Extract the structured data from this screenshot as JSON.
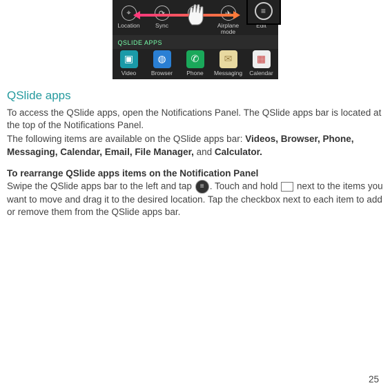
{
  "screenshot": {
    "toggles": [
      {
        "name": "location",
        "label": "Location",
        "glyph": "⌖"
      },
      {
        "name": "sync",
        "label": "Sync",
        "glyph": "⟳"
      },
      {
        "name": "blank",
        "label": "",
        "glyph": ""
      },
      {
        "name": "airplane",
        "label": "Airplane\nmode",
        "glyph": "✈"
      },
      {
        "name": "edit",
        "label": "Edit",
        "glyph": "≡"
      }
    ],
    "section_label": "QSLIDE APPS",
    "apps": [
      {
        "name": "video",
        "label": "Video",
        "glyph": "▣"
      },
      {
        "name": "browser",
        "label": "Browser",
        "glyph": "◍"
      },
      {
        "name": "phone",
        "label": "Phone",
        "glyph": "✆"
      },
      {
        "name": "messaging",
        "label": "Messaging",
        "glyph": "✉"
      },
      {
        "name": "calendar",
        "label": "Calendar",
        "glyph": "▦"
      }
    ]
  },
  "heading": "QSlide apps",
  "para1": "To access the QSlide apps, open the Notifications Panel. The QSlide apps bar is located at the top of the Notifications Panel.",
  "para2_prefix": "The following items are available on the QSlide apps bar: ",
  "para2_bold": "Videos, Browser, Phone, Messaging, Calendar, Email, File Manager,",
  "para2_and": " and ",
  "para2_bold2": "Calculator.",
  "subhead": "To rearrange QSlide apps items on the Notification Panel",
  "para3_a": "Swipe the QSlide apps bar to the left and tap ",
  "para3_b": ". Touch and hold ",
  "para3_c": " next to the items you want to move and drag it to the desired location. Tap the checkbox next to each item to add or remove them from the QSlide apps bar.",
  "page_number": "25"
}
